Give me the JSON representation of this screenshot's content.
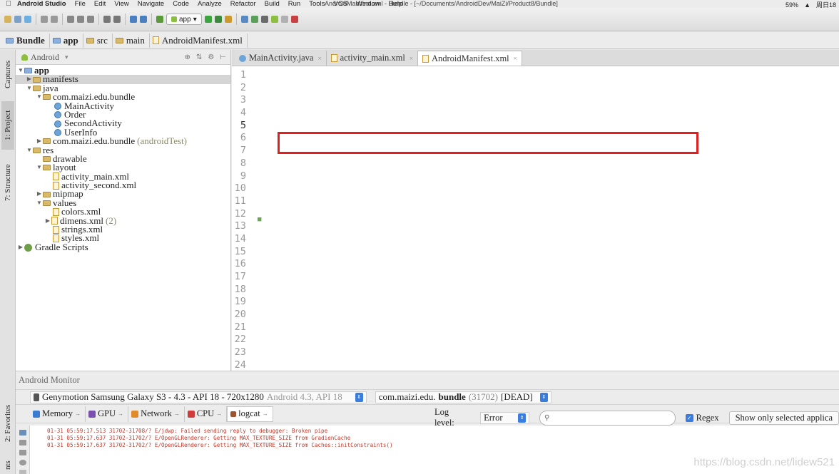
{
  "menubar": {
    "app_name": "Android Studio",
    "menus": [
      "File",
      "Edit",
      "View",
      "Navigate",
      "Code",
      "Analyze",
      "Refactor",
      "Build",
      "Run",
      "Tools",
      "VCS",
      "Window",
      "Help"
    ],
    "window_title": "AndroidManifest.xml - Bundle - [~/Documents/AndroidDev/MaiZi/Product8/Bundle]",
    "battery": "59%",
    "clock": "周日18"
  },
  "toolbar": {
    "run_config": "app"
  },
  "breadcrumb": {
    "items": [
      "Bundle",
      "app",
      "src",
      "main",
      "AndroidManifest.xml"
    ]
  },
  "leftstrip": {
    "captures": "Captures",
    "project": "1: Project",
    "structure": "7: Structure",
    "favorites": "2: Favorites",
    "build_variants": "nts"
  },
  "project": {
    "view_mode": "Android",
    "tree": [
      {
        "label": "app",
        "extra": ""
      },
      {
        "label": "manifests",
        "extra": ""
      },
      {
        "label": "java",
        "extra": ""
      },
      {
        "label": "com.maizi.edu.bundle",
        "extra": ""
      },
      {
        "label": "MainActivity",
        "extra": ""
      },
      {
        "label": "Order",
        "extra": ""
      },
      {
        "label": "SecondActivity",
        "extra": ""
      },
      {
        "label": "UserInfo",
        "extra": ""
      },
      {
        "label": "com.maizi.edu.bundle",
        "extra": "(androidTest)"
      },
      {
        "label": "res",
        "extra": ""
      },
      {
        "label": "drawable",
        "extra": ""
      },
      {
        "label": "layout",
        "extra": ""
      },
      {
        "label": "activity_main.xml",
        "extra": ""
      },
      {
        "label": "activity_second.xml",
        "extra": ""
      },
      {
        "label": "mipmap",
        "extra": ""
      },
      {
        "label": "values",
        "extra": ""
      },
      {
        "label": "colors.xml",
        "extra": ""
      },
      {
        "label": "dimens.xml",
        "extra": "(2)"
      },
      {
        "label": "strings.xml",
        "extra": ""
      },
      {
        "label": "styles.xml",
        "extra": ""
      },
      {
        "label": "Gradle Scripts",
        "extra": ""
      }
    ]
  },
  "editor": {
    "tabs": [
      "MainActivity.java",
      "activity_main.xml",
      "AndroidManifest.xml"
    ],
    "line_numbers": [
      "1",
      "2",
      "3",
      "4",
      "5",
      "6",
      "7",
      "8",
      "9",
      "10",
      "11",
      "12",
      "13",
      "14",
      "15",
      "16",
      "17",
      "18",
      "19",
      "20",
      "21",
      "22",
      "23",
      "24"
    ]
  },
  "monitor": {
    "title": "Android Monitor",
    "device": "Genymotion Samsung Galaxy S3 - 4.3 - API 18 - 720x1280",
    "device_extra": "Android 4.3, API 18",
    "process_prefix": "com.maizi.edu.",
    "process_bold": "bundle",
    "process_pid": "(31702)",
    "process_state": "[DEAD]",
    "tabs": [
      "Memory",
      "GPU",
      "Network",
      "CPU",
      "logcat"
    ],
    "log_level_label": "Log level:",
    "log_level_value": "Error",
    "search_placeholder": "",
    "regex_label": "Regex",
    "show_only_label": "Show only selected applica",
    "log_lines": [
      "01-31 05:59:17.513 31702-31708/? E/jdwp: Failed sending reply to debugger: Broken pipe",
      "01-31 05:59:17.637 31702-31702/? E/OpenGLRenderer: Getting MAX_TEXTURE_SIZE from GradienCache",
      "01-31 05:59:17.637 31702-31702/? E/OpenGLRenderer: Getting MAX_TEXTURE_SIZE from Caches::initConstraints()"
    ]
  },
  "watermark": "https://blog.csdn.net/lidew521",
  "colors": {
    "tag": "#000080",
    "attribute": "#660e7a",
    "value": "#008000",
    "highlight_box": "#e02020",
    "log_error": "#c0392b"
  }
}
